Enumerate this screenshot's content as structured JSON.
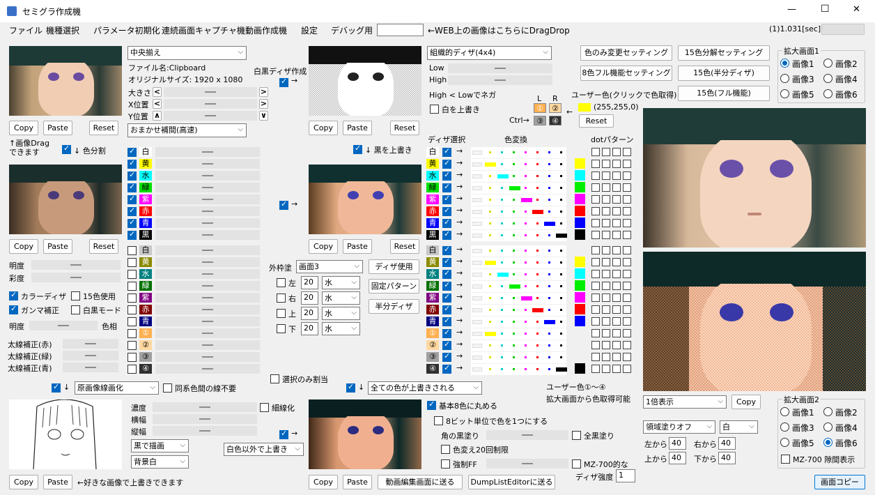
{
  "window": {
    "title": "セミグラ作成機",
    "minimize": "—",
    "maximize": "☐",
    "close": "✕"
  },
  "menu": [
    "ファイル",
    "機種選択",
    "パラメータ初期化",
    "連続画面キャプチャ機",
    "動画作成機",
    "設定",
    "デバッグ用"
  ],
  "drop_hint": "←WEB上の画像はこちらにDragDrop",
  "timing": "(1)1.031[sec]",
  "left": {
    "align": "中央揃え",
    "filename": "ファイル名:Clipboard",
    "origsize": "オリジナルサイズ: 1920 x 1080",
    "size_lbl": "大きさ",
    "xpos_lbl": "X位置",
    "ypos_lbl": "Y位置",
    "interp": "おまかせ補間(高速)",
    "copy": "Copy",
    "paste": "Paste",
    "reset": "Reset",
    "drag_note1": "↑画像Drag",
    "drag_note2": "できます",
    "split": "↓ 色分割",
    "brightness": "明度",
    "saturation": "彩度",
    "color_dither": "カラーディザ",
    "use15": "15色使用",
    "gamma": "ガンマ補正",
    "mono": "白黒モード",
    "brightness2": "明度",
    "hue": "色相",
    "thick_r": "太線補正(赤)",
    "thick_g": "太線補正(緑)",
    "thick_b": "太線補正(青)",
    "lineart": "原画像線画化",
    "same_line": "同系色間の線不要",
    "density": "濃度",
    "hwidth": "横幅",
    "vwidth": "縦幅",
    "thin": "細線化",
    "draw_black": "黒で描画",
    "bg_white": "背景白",
    "overwrite_note": "←好きな画像で上書きできます"
  },
  "colors": [
    {
      "name": "白",
      "bg": "#ffffff",
      "fg": "#000000",
      "on": true
    },
    {
      "name": "黄",
      "bg": "#ffff00",
      "fg": "#000000",
      "on": true
    },
    {
      "name": "水",
      "bg": "#00ffff",
      "fg": "#000000",
      "on": true
    },
    {
      "name": "緑",
      "bg": "#00e000",
      "fg": "#000000",
      "on": true
    },
    {
      "name": "紫",
      "bg": "#ff00ff",
      "fg": "#ffffff",
      "on": true
    },
    {
      "name": "赤",
      "bg": "#ff0000",
      "fg": "#ffffff",
      "on": true
    },
    {
      "name": "青",
      "bg": "#0000ff",
      "fg": "#ffffff",
      "on": true
    },
    {
      "name": "黒",
      "bg": "#000000",
      "fg": "#ffffff",
      "on": true
    },
    {
      "name": "白",
      "bg": "#c8c8c8",
      "fg": "#000000",
      "on": false
    },
    {
      "name": "黄",
      "bg": "#8a8a00",
      "fg": "#ffffff",
      "on": false
    },
    {
      "name": "水",
      "bg": "#008080",
      "fg": "#ffffff",
      "on": false
    },
    {
      "name": "緑",
      "bg": "#007000",
      "fg": "#ffffff",
      "on": false
    },
    {
      "name": "紫",
      "bg": "#800080",
      "fg": "#ffffff",
      "on": false
    },
    {
      "name": "赤",
      "bg": "#800000",
      "fg": "#ffffff",
      "on": false
    },
    {
      "name": "青",
      "bg": "#000080",
      "fg": "#ffffff",
      "on": false
    },
    {
      "name": "①",
      "bg": "#ffb050",
      "fg": "#ffffff",
      "on": false
    },
    {
      "name": "②",
      "bg": "#ffd8a0",
      "fg": "#000000",
      "on": false
    },
    {
      "name": "③",
      "bg": "#a0a0a0",
      "fg": "#000000",
      "on": false
    },
    {
      "name": "④",
      "bg": "#303030",
      "fg": "#ffffff",
      "on": false
    }
  ],
  "mid": {
    "mono_dither": "白黒ディザ作成",
    "black_over": "↓ 黒を上書き",
    "outer_lbl": "外枠塗",
    "outer_val": "画面3",
    "dither_use": "ディザ使用",
    "fixed_pattern": "固定パターン",
    "half_dither": "半分ディザ",
    "sides": [
      {
        "l": "左",
        "n": "20",
        "c": "水"
      },
      {
        "l": "右",
        "n": "20",
        "c": "水"
      },
      {
        "l": "上",
        "n": "20",
        "c": "水"
      },
      {
        "l": "下",
        "n": "20",
        "c": "水"
      }
    ],
    "select_only": "選択のみ割当",
    "all_over": "全ての色が上書きされる",
    "non_white": "白色以外で上書き",
    "send_video": "動画編集画面に送る",
    "send_dump": "DumpListEditorに送る"
  },
  "right": {
    "dither_type": "組織的ディザ(4x4)",
    "low": "Low",
    "high": "High",
    "neg_note": "High < Lowでネガ",
    "white_over": "白を上書き",
    "L": "L",
    "R": "R",
    "ctrl": "Ctrl→",
    "user_hint": "ユーザー色(クリックで色取得)",
    "user_rgb": "(255,255,0)",
    "user_color": "#ffff00",
    "dither_sel": "ディザ選択",
    "color_conv": "色変換",
    "dot_pattern": "dotパターン",
    "user_note1": "ユーザー色①～④",
    "user_note2": "拡大画面から色取得可能",
    "round8": "基本8色に丸める",
    "unit8": "8ビット単位で色を1つにする",
    "corner": "角の黒塗り",
    "fill_all": "全黒塗り",
    "limit20": "色変え20回制限",
    "force_ff": "強制FF",
    "mz700": "MZ-700的な",
    "dither_strength": "ディザ強度",
    "strength_val": "1"
  },
  "presets": [
    "色のみ変更セッティング",
    "15色分解セッティング",
    "8色フル機能セッティング",
    "15色(半分ディザ)",
    "15色(フル機能)"
  ],
  "zoom1": {
    "title": "拡大画面1",
    "opts": [
      "画像1",
      "画像2",
      "画像3",
      "画像4",
      "画像5",
      "画像6"
    ],
    "sel": 0
  },
  "zoom2": {
    "title": "拡大画面2",
    "opts": [
      "画像1",
      "画像2",
      "画像3",
      "画像4",
      "画像5",
      "画像6"
    ],
    "sel": 5,
    "mz": "MZ-700 隙間表示"
  },
  "view": {
    "scale": "1倍表示",
    "copy": "Copy",
    "fill": "領域塗りオフ",
    "fill_color": "白",
    "left_lbl": "左から",
    "left": "40",
    "right_lbl": "右から",
    "right": "40",
    "top_lbl": "上から",
    "top": "40",
    "bottom_lbl": "下から",
    "bottom": "40",
    "screen_copy": "画面コピー"
  }
}
